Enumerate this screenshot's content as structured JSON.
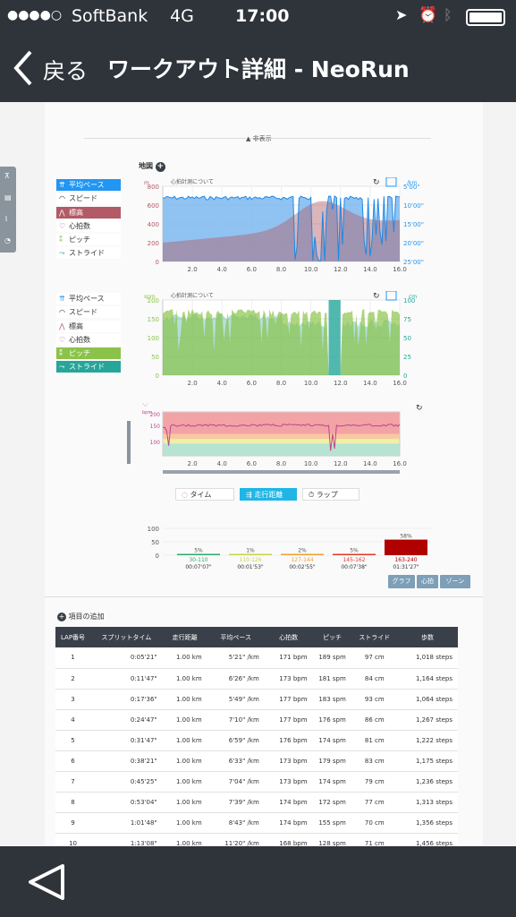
{
  "status": {
    "carrier": "SoftBank",
    "network": "4G",
    "time": "17:00"
  },
  "nav": {
    "back": "戻る",
    "title": "ワークアウト詳細 - NeoRun"
  },
  "hide_label": "非表示",
  "map_label": "地図",
  "chart1": {
    "note": "心拍計測について",
    "left_unit": "m",
    "right_unit": "/km",
    "left_ticks": [
      "800",
      "600",
      "400",
      "200",
      "0"
    ],
    "right_ticks": [
      "5'00\"",
      "10'00\"",
      "15'00\"",
      "20'00\"",
      "25'00\""
    ],
    "x_ticks": [
      "2.0",
      "4.0",
      "6.0",
      "8.0",
      "10.0",
      "12.0",
      "14.0",
      "16.0"
    ]
  },
  "chart2": {
    "note": "心拍計測について",
    "left_unit": "spm",
    "right_unit": "cm",
    "left_ticks": [
      "200",
      "150",
      "100",
      "50",
      "0"
    ],
    "right_ticks": [
      "100",
      "75",
      "50",
      "25",
      "0"
    ],
    "x_ticks": [
      "2.0",
      "4.0",
      "6.0",
      "8.0",
      "10.0",
      "12.0",
      "14.0",
      "16.0"
    ]
  },
  "chart3": {
    "unit": "bpm",
    "ticks": [
      "200",
      "150",
      "100"
    ],
    "x_ticks": [
      "2.0",
      "4.0",
      "6.0",
      "8.0",
      "10.0",
      "12.0",
      "14.0",
      "16.0"
    ]
  },
  "legend1": [
    "平均ペース",
    "スピード",
    "標高",
    "心拍数",
    "ピッチ",
    "ストライド"
  ],
  "legend2": [
    "平均ペース",
    "スピード",
    "標高",
    "心拍数",
    "ピッチ",
    "ストライド"
  ],
  "segments": [
    "タイム",
    "走行距離",
    "ラップ"
  ],
  "zone_chart": {
    "yticks": [
      "100",
      "50",
      "0"
    ],
    "zones": [
      {
        "pct": "5%",
        "range": "30-110",
        "time": "00:07'07\"",
        "color": "#2eaa6a"
      },
      {
        "pct": "1%",
        "range": "110-126",
        "time": "00:01'53\"",
        "color": "#c8d44a"
      },
      {
        "pct": "2%",
        "range": "127-144",
        "time": "00:02'55\"",
        "color": "#f0a030"
      },
      {
        "pct": "5%",
        "range": "145-162",
        "time": "00:07'38\"",
        "color": "#e03a2a"
      },
      {
        "pct": "58%",
        "range": "163-240",
        "time": "01:31'27\"",
        "color": "#b00000"
      }
    ]
  },
  "zone_buttons": [
    "グラフ",
    "心拍",
    "ゾーン"
  ],
  "add_item": "項目の追加",
  "table": {
    "headers": [
      "LAP番号",
      "スプリットタイム",
      "走行距離",
      "平均ペース",
      "心拍数",
      "ピッチ",
      "ストライド",
      "歩数"
    ],
    "rows": [
      [
        "1",
        "0:05'21\"",
        "1.00 km",
        "5'21\" /km",
        "171 bpm",
        "189 spm",
        "97 cm",
        "1,018 steps"
      ],
      [
        "2",
        "0:11'47\"",
        "1.00 km",
        "6'26\" /km",
        "173 bpm",
        "181 spm",
        "84 cm",
        "1,164 steps"
      ],
      [
        "3",
        "0:17'36\"",
        "1.00 km",
        "5'49\" /km",
        "177 bpm",
        "183 spm",
        "93 cm",
        "1,064 steps"
      ],
      [
        "4",
        "0:24'47\"",
        "1.00 km",
        "7'10\" /km",
        "177 bpm",
        "176 spm",
        "86 cm",
        "1,267 steps"
      ],
      [
        "5",
        "0:31'47\"",
        "1.00 km",
        "6'59\" /km",
        "176 bpm",
        "174 spm",
        "81 cm",
        "1,222 steps"
      ],
      [
        "6",
        "0:38'21\"",
        "1.00 km",
        "6'33\" /km",
        "173 bpm",
        "179 spm",
        "83 cm",
        "1,175 steps"
      ],
      [
        "7",
        "0:45'25\"",
        "1.00 km",
        "7'04\" /km",
        "173 bpm",
        "174 spm",
        "79 cm",
        "1,236 steps"
      ],
      [
        "8",
        "0:53'04\"",
        "1.00 km",
        "7'39\" /km",
        "174 bpm",
        "172 spm",
        "77 cm",
        "1,313 steps"
      ],
      [
        "9",
        "1:01'48\"",
        "1.00 km",
        "8'43\" /km",
        "174 bpm",
        "155 spm",
        "70 cm",
        "1,356 steps"
      ],
      [
        "10",
        "1:13'08\"",
        "1.00 km",
        "11'20\" /km",
        "168 bpm",
        "128 spm",
        "71 cm",
        "1,456 steps"
      ]
    ]
  },
  "colors": {
    "bar": "#2f343b",
    "pace": "#2196f3",
    "elev": "#b25a66",
    "pitch": "#8bc34a",
    "stride": "#26a69a"
  }
}
